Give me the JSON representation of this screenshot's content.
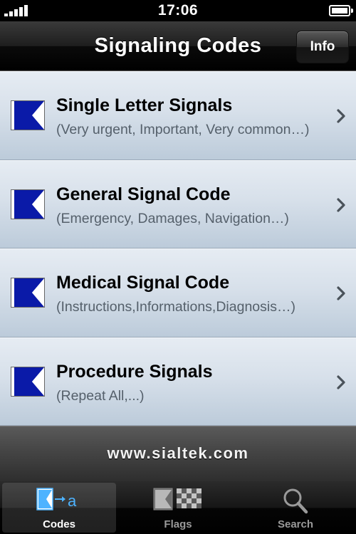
{
  "status_bar": {
    "time": "17:06"
  },
  "nav": {
    "title": "Signaling Codes",
    "info_label": "Info"
  },
  "list": {
    "items": [
      {
        "title": "Single Letter Signals",
        "subtitle": "(Very urgent, Important, Very common…)",
        "icon": "code-flag-icon"
      },
      {
        "title": "General Signal Code",
        "subtitle": "(Emergency, Damages, Navigation…)",
        "icon": "code-flag-icon"
      },
      {
        "title": "Medical Signal Code",
        "subtitle": "(Instructions,Informations,Diagnosis…)",
        "icon": "code-flag-icon"
      },
      {
        "title": "Procedure Signals",
        "subtitle": "(Repeat All,...)",
        "icon": "code-flag-icon"
      }
    ]
  },
  "footer": {
    "url": "www.sialtek.com"
  },
  "tabs": [
    {
      "label": "Codes",
      "icon": "codes-tab-icon",
      "selected": true
    },
    {
      "label": "Flags",
      "icon": "flags-tab-icon",
      "selected": false
    },
    {
      "label": "Search",
      "icon": "search-icon",
      "selected": false
    }
  ],
  "colors": {
    "flag_blue": "#0a1aa8",
    "tab_selected": "#ffffff",
    "tab_inactive": "#9a9a9a",
    "codes_icon_accent": "#4db3ff"
  }
}
